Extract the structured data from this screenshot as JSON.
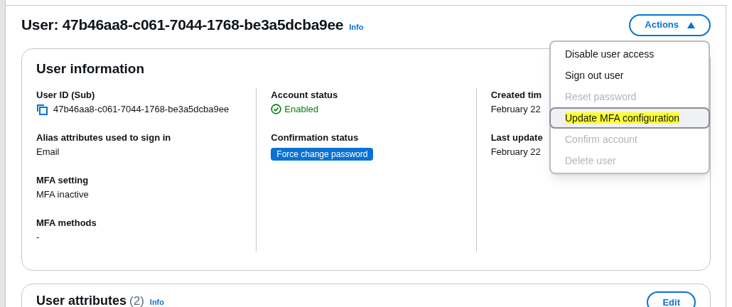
{
  "header": {
    "title": "User: 47b46aa8-c061-7044-1768-be3a5dcba9ee",
    "info_link": "Info",
    "actions_button": {
      "label": "Actions",
      "expanded": true
    }
  },
  "user_information": {
    "title": "User information",
    "columns": [
      [
        {
          "label": "User ID (Sub)",
          "value": "47b46aa8-c061-7044-1768-be3a5dcba9ee",
          "kind": "copy"
        },
        {
          "label": "Alias attributes used to sign in",
          "value": "Email",
          "kind": "text"
        },
        {
          "label": "MFA setting",
          "value": "MFA inactive",
          "kind": "text"
        },
        {
          "label": "MFA methods",
          "value": "-",
          "kind": "text"
        }
      ],
      [
        {
          "label": "Account status",
          "value": "Enabled",
          "kind": "status"
        },
        {
          "label": "Confirmation status",
          "value": "Force change password",
          "kind": "badge"
        }
      ],
      [
        {
          "label": "Created tim",
          "value": "February 22",
          "kind": "text"
        },
        {
          "label": "Last update",
          "value": "February 22",
          "kind": "text"
        }
      ]
    ]
  },
  "actions_menu": [
    {
      "label": "Disable user access",
      "disabled": false,
      "selected": false,
      "highlighted": false
    },
    {
      "label": "Sign out user",
      "disabled": false,
      "selected": false,
      "highlighted": false
    },
    {
      "label": "Reset password",
      "disabled": true,
      "selected": false,
      "highlighted": false
    },
    {
      "label": "Update MFA configuration",
      "disabled": false,
      "selected": true,
      "highlighted": true
    },
    {
      "label": "Confirm account",
      "disabled": true,
      "selected": false,
      "highlighted": false
    },
    {
      "label": "Delete user",
      "disabled": true,
      "selected": false,
      "highlighted": false
    }
  ],
  "user_attributes": {
    "title": "User attributes",
    "count": "(2)",
    "info_link": "Info",
    "edit_button": "Edit"
  }
}
